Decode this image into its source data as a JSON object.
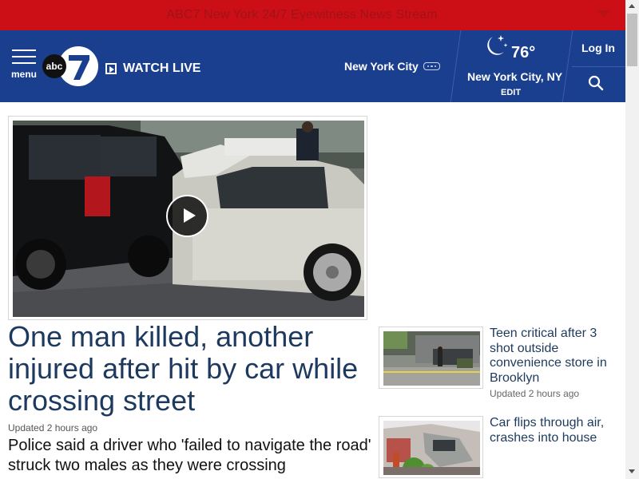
{
  "live_bar": {
    "text": "ABC7 New York 24/7 Eyewitness News Stream",
    "chevron_icon": "chevron-down-icon"
  },
  "header": {
    "menu_label": "menu",
    "logo_text": "abc7",
    "watch_live_label": "WATCH LIVE",
    "city_select": "New York City",
    "weather": {
      "icon": "moon-stars-icon",
      "temperature": "76°",
      "location": "New York City, NY",
      "edit_label": "EDIT"
    },
    "login_label": "Log In",
    "search_icon": "search-icon"
  },
  "lead_story": {
    "headline": "One man killed, another injured after hit by car while crossing street",
    "updated": "Updated 2 hours ago",
    "description": "Police said a driver who 'failed to navigate the road' struck two males as they were crossing"
  },
  "side_stories": [
    {
      "title": "Teen critical after 3 shot outside convenience store in Brooklyn",
      "updated": "Updated 2 hours ago"
    },
    {
      "title": "Car flips through air, crashes into house",
      "updated": ""
    }
  ],
  "colors": {
    "live_bar": "#cc0f16",
    "header": "#1b3f8f",
    "headline": "#1d3a5e"
  }
}
